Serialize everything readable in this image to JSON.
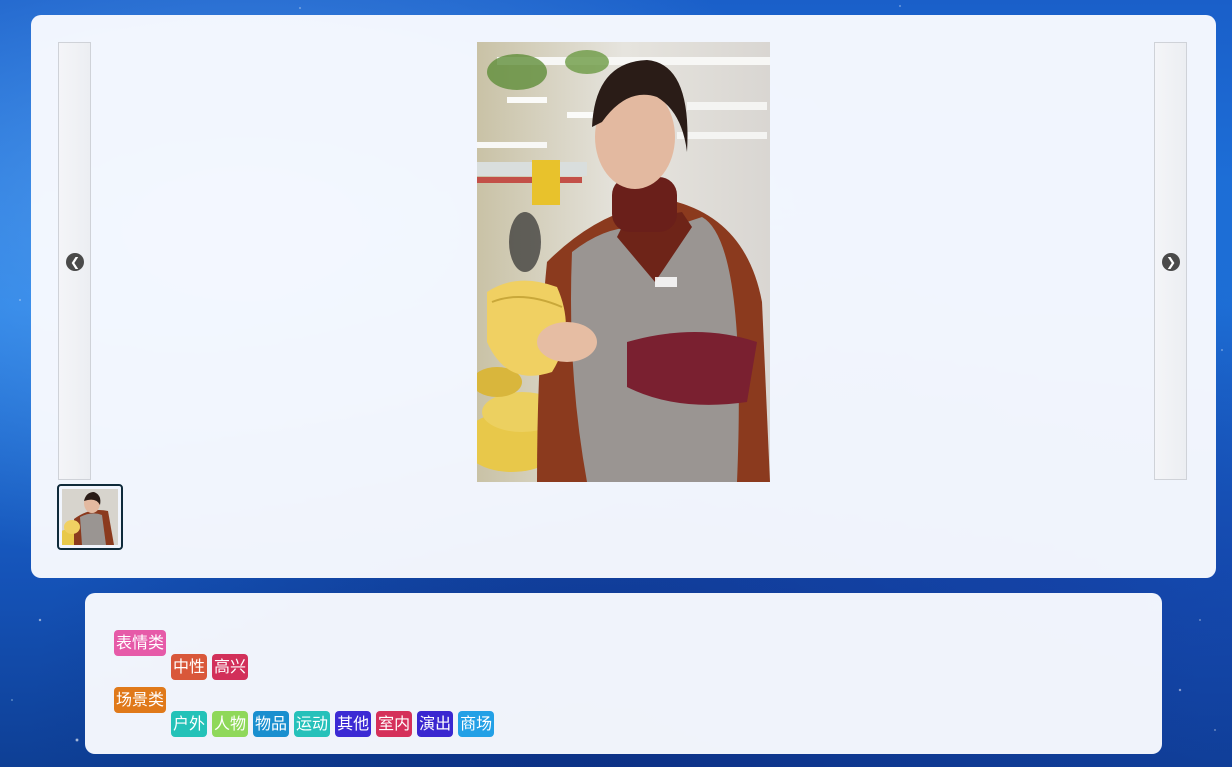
{
  "gallery": {
    "prev_icon": "chevron-left-icon",
    "next_icon": "chevron-right-icon",
    "prev_glyph": "❮",
    "next_glyph": "❯"
  },
  "tags": {
    "groups": [
      {
        "category": "表情类",
        "category_color": "#e65aa8",
        "items": [
          {
            "label": "中性",
            "color": "#d9573a"
          },
          {
            "label": "高兴",
            "color": "#d2305a"
          }
        ]
      },
      {
        "category": "场景类",
        "category_color": "#e0791a",
        "items": [
          {
            "label": "户外",
            "color": "#24c2b8"
          },
          {
            "label": "人物",
            "color": "#8fd85a"
          },
          {
            "label": "物品",
            "color": "#1a8fcf"
          },
          {
            "label": "运动",
            "color": "#26c1ba"
          },
          {
            "label": "其他",
            "color": "#3c2ad4"
          },
          {
            "label": "室内",
            "color": "#d5305a"
          },
          {
            "label": "演出",
            "color": "#3a27d0"
          },
          {
            "label": "商场",
            "color": "#23a0e6"
          }
        ]
      }
    ]
  }
}
